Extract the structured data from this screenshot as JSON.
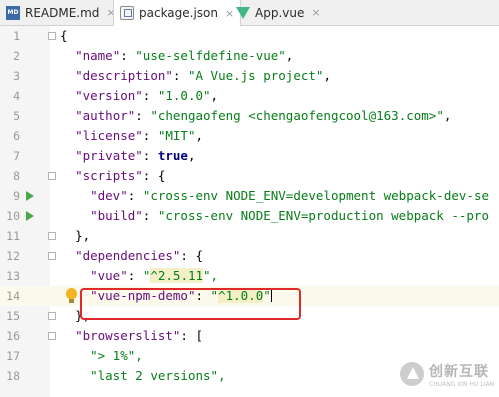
{
  "tabs": [
    {
      "label": "README.md",
      "icon": "markdown-file-icon",
      "icon_text": "MD"
    },
    {
      "label": "package.json",
      "icon": "json-file-icon"
    },
    {
      "label": "App.vue",
      "icon": "vue-file-icon"
    }
  ],
  "close_glyph": "×",
  "lines": [
    {
      "n": "1",
      "code": "{"
    },
    {
      "n": "2",
      "key": "\"name\"",
      "val": "\"use-selfdefine-vue\""
    },
    {
      "n": "3",
      "key": "\"description\"",
      "val": "\"A Vue.js project\""
    },
    {
      "n": "4",
      "key": "\"version\"",
      "val": "\"1.0.0\""
    },
    {
      "n": "5",
      "key": "\"author\"",
      "val": "\"chengaofeng <chengaofengcool@163.com>\""
    },
    {
      "n": "6",
      "key": "\"license\"",
      "val": "\"MIT\""
    },
    {
      "n": "7",
      "key": "\"private\"",
      "val": "true"
    },
    {
      "n": "8",
      "key": "\"scripts\"",
      "val": "{"
    },
    {
      "n": "9",
      "key": "\"dev\"",
      "val": "\"cross-env NODE_ENV=development webpack-dev-se"
    },
    {
      "n": "10",
      "key": "\"build\"",
      "val": "\"cross-env NODE_ENV=production webpack --pro"
    },
    {
      "n": "11",
      "code": "},"
    },
    {
      "n": "12",
      "key": "\"dependencies\"",
      "val": "{"
    },
    {
      "n": "13",
      "key": "\"vue\"",
      "val_prefix": "\"",
      "val_hl": "^2.5.11",
      "val_suffix": "\","
    },
    {
      "n": "14",
      "key": "\"vue-npm-demo\"",
      "val_prefix": "\"",
      "val_hl": "^1.0.0",
      "val_suffix": "\""
    },
    {
      "n": "15",
      "code": "},"
    },
    {
      "n": "16",
      "key": "\"browserslist\"",
      "val": "["
    },
    {
      "n": "17",
      "val": "\"> 1%\","
    },
    {
      "n": "18",
      "val": "\"last 2 versions\","
    }
  ],
  "watermark": {
    "cn": "创新互联",
    "en": "CHUANG XIN HU LIAN"
  },
  "colors": {
    "annotation_box": "#e02a2a",
    "run_icon": "#49a84a",
    "key": "#660e7a",
    "string": "#067d17"
  }
}
